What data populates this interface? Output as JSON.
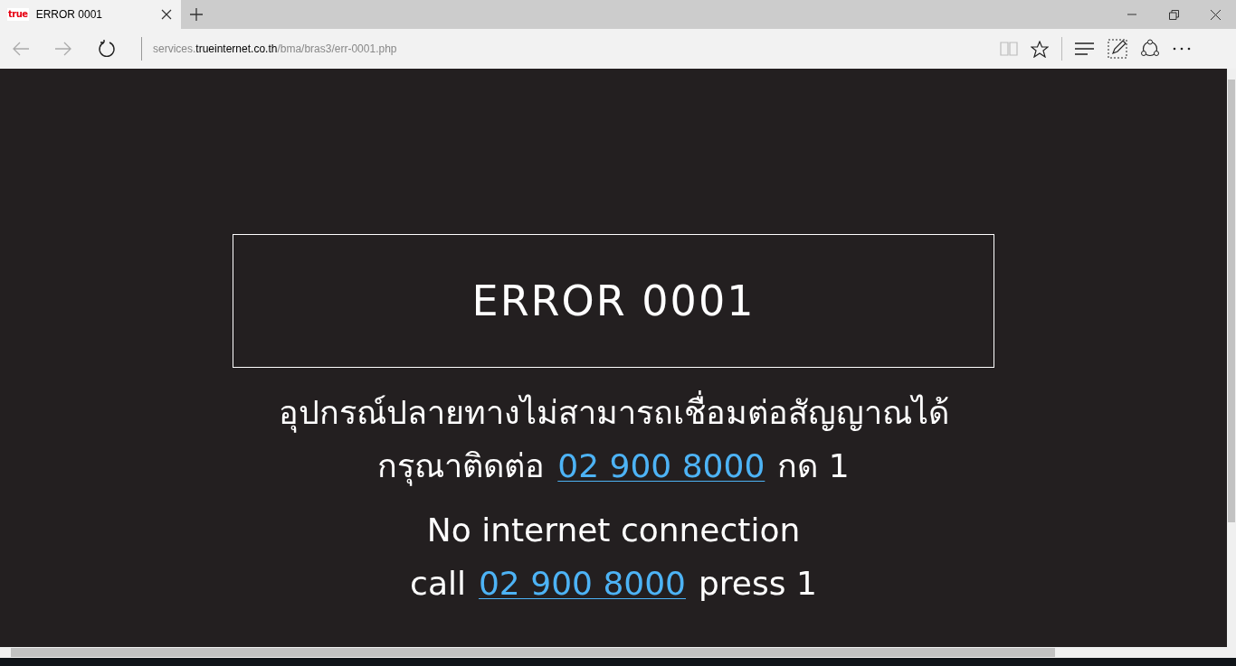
{
  "tab": {
    "favicon_text": "true",
    "title": "ERROR 0001",
    "selected": true
  },
  "address_bar": {
    "url_prefix": "services.",
    "url_domain": "trueinternet.co.th",
    "url_path": "/bma/bras3/err-0001.php"
  },
  "page": {
    "heading": "ERROR 0001",
    "lines": [
      {
        "parts": [
          {
            "text": "อุปกรณ์ปลายทางไม่สามารถเชื่อมต่อสัญญาณได้",
            "kind": "text"
          }
        ]
      },
      {
        "parts": [
          {
            "text": "กรุณาติดต่อ",
            "kind": "text"
          },
          {
            "text": "02 900 8000",
            "kind": "link"
          },
          {
            "text": "กด 1",
            "kind": "text"
          }
        ]
      },
      {
        "parts": [
          {
            "text": "No internet connection",
            "kind": "text"
          }
        ]
      },
      {
        "parts": [
          {
            "text": "call",
            "kind": "text"
          },
          {
            "text": "02 900 8000",
            "kind": "link"
          },
          {
            "text": "press 1",
            "kind": "text"
          }
        ]
      }
    ]
  }
}
